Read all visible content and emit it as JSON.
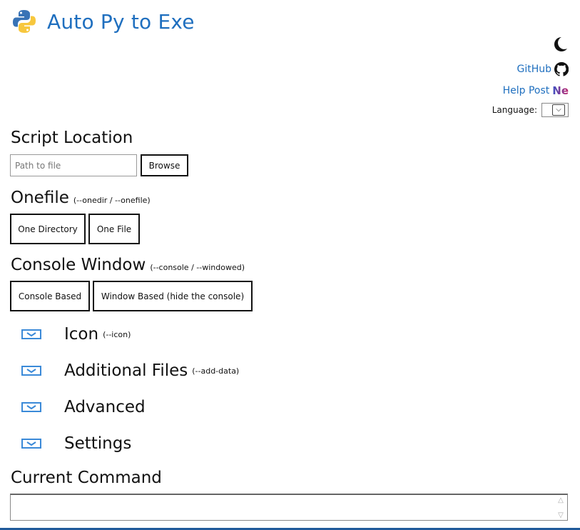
{
  "app": {
    "title": "Auto Py to Exe"
  },
  "topright": {
    "github_label": "GitHub",
    "help_label": "Help Post",
    "help_badge": "Ne",
    "language_label": "Language:"
  },
  "script_location": {
    "title": "Script Location",
    "placeholder": "Path to file",
    "browse_label": "Browse"
  },
  "onefile": {
    "title": "Onefile",
    "flag": "(--onedir / --onefile)",
    "option1": "One Directory",
    "option2": "One File"
  },
  "console": {
    "title": "Console Window",
    "flag": "(--console / --windowed)",
    "option1": "Console Based",
    "option2": "Window Based (hide the console)"
  },
  "sections": {
    "icon": {
      "title": "Icon",
      "flag": "(--icon)"
    },
    "files": {
      "title": "Additional Files",
      "flag": "(--add-data)"
    },
    "advanced": {
      "title": "Advanced"
    },
    "settings": {
      "title": "Settings"
    }
  },
  "command": {
    "title": "Current Command",
    "value": ""
  },
  "colors": {
    "accent": "#1f6fbf",
    "chevron": "#3b8ad8",
    "bottom_bar": "#1f5a9a"
  }
}
